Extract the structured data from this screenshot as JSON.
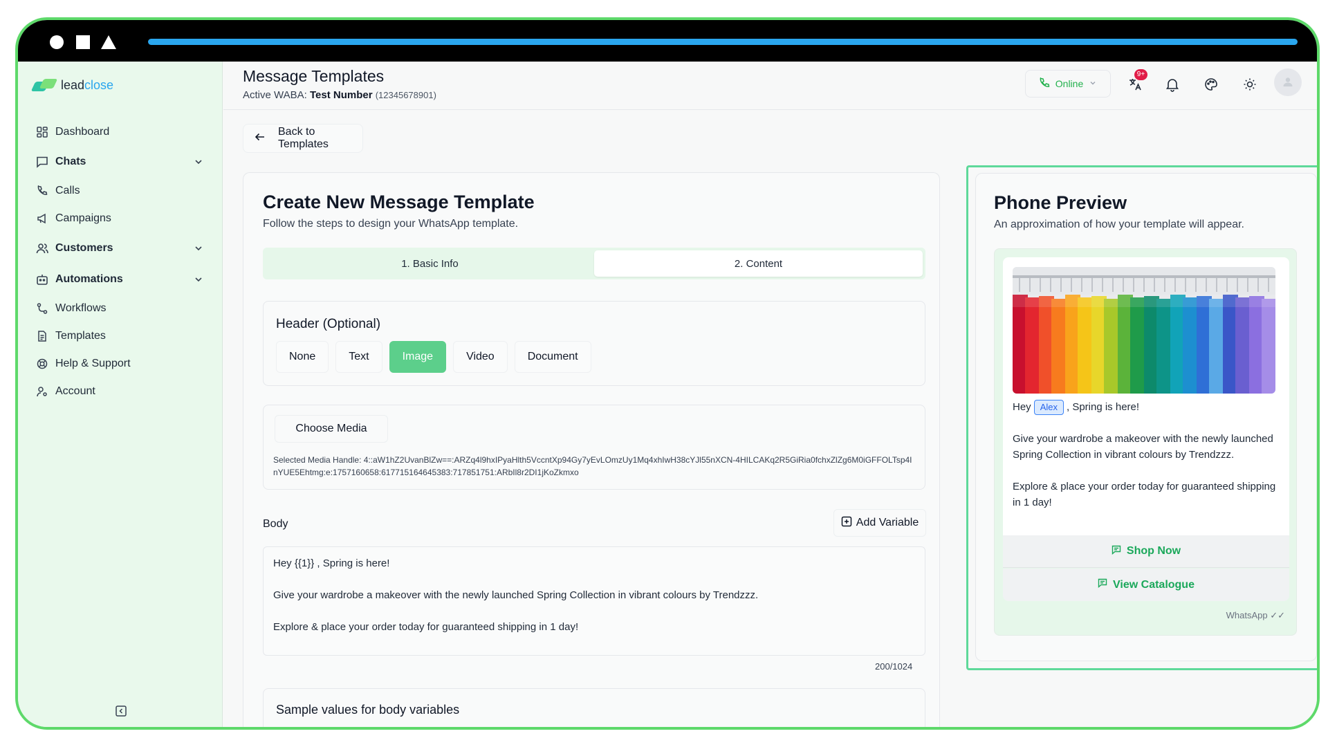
{
  "app": {
    "brand_prefix": "lead",
    "brand_suffix": "close"
  },
  "sidebar": {
    "items": [
      {
        "label": "Dashboard",
        "icon": "dashboard-icon"
      },
      {
        "label": "Chats",
        "icon": "chat-icon",
        "expandable": true
      },
      {
        "label": "Calls",
        "icon": "phone-icon"
      },
      {
        "label": "Campaigns",
        "icon": "megaphone-icon"
      },
      {
        "label": "Customers",
        "icon": "users-icon",
        "expandable": true
      },
      {
        "label": "Automations",
        "icon": "bot-icon",
        "expandable": true
      },
      {
        "label": "Workflows",
        "icon": "workflow-icon"
      },
      {
        "label": "Templates",
        "icon": "document-icon"
      },
      {
        "label": "Help & Support",
        "icon": "lifebuoy-icon"
      },
      {
        "label": "Account",
        "icon": "user-settings-icon"
      }
    ]
  },
  "header": {
    "title": "Message Templates",
    "waba_prefix": "Active WABA: ",
    "waba_name": "Test Number",
    "waba_number": "(12345678901)",
    "status": "Online",
    "notification_badge": "9+"
  },
  "back_button": "Back to Templates",
  "form": {
    "title": "Create New Message Template",
    "subtitle": "Follow the steps to design your WhatsApp template.",
    "steps": [
      "1. Basic Info",
      "2. Content"
    ],
    "active_step": 1,
    "header_section": {
      "title": "Header (Optional)",
      "options": [
        "None",
        "Text",
        "Image",
        "Video",
        "Document"
      ],
      "selected": "Image"
    },
    "media": {
      "button": "Choose Media",
      "handle_text": "Selected Media Handle: 4::aW1hZ2UvanBlZw==:ARZq4l9hxIPyaHlth5VccntXp94Gy7yEvLOmzUy1Mq4xhIwH38cYJl55nXCN-4HILCAKq2R5GiRia0fchxZlZg6M0iGFFOLTsp4InYUE5Ehtmg:e:1757160658:617715164645383:717851751:ARbIl8r2DI1jKoZkmxo"
    },
    "body": {
      "label": "Body",
      "add_variable": "Add Variable",
      "text": "Hey {{1}} , Spring is here!\n\nGive your wardrobe a makeover with the newly launched Spring Collection in vibrant colours by Trendzzz.\n\nExplore & place your order today for guaranteed shipping in 1 day!",
      "counter": "200/1024"
    },
    "samples_title": "Sample values for body variables"
  },
  "preview": {
    "title": "Phone Preview",
    "subtitle": "An approximation of how your template will appear.",
    "greeting_before": "Hey",
    "variable_value": "Alex",
    "greeting_after": ", Spring is here!",
    "paragraph_1": "Give your wardrobe a makeover with the newly launched Spring Collection in vibrant colours by Trendzzz.",
    "paragraph_2": "Explore & place your order today for guaranteed shipping in 1 day!",
    "buttons": [
      "Shop Now",
      "View Catalogue"
    ],
    "footer": "WhatsApp ✓✓"
  },
  "colors": {
    "accent_green": "#5ccf8b",
    "sidebar_bg": "#e9f9ec",
    "preview_border": "#5ed99a",
    "frame_border": "#5ed96a",
    "link_green": "#1aa85a"
  }
}
